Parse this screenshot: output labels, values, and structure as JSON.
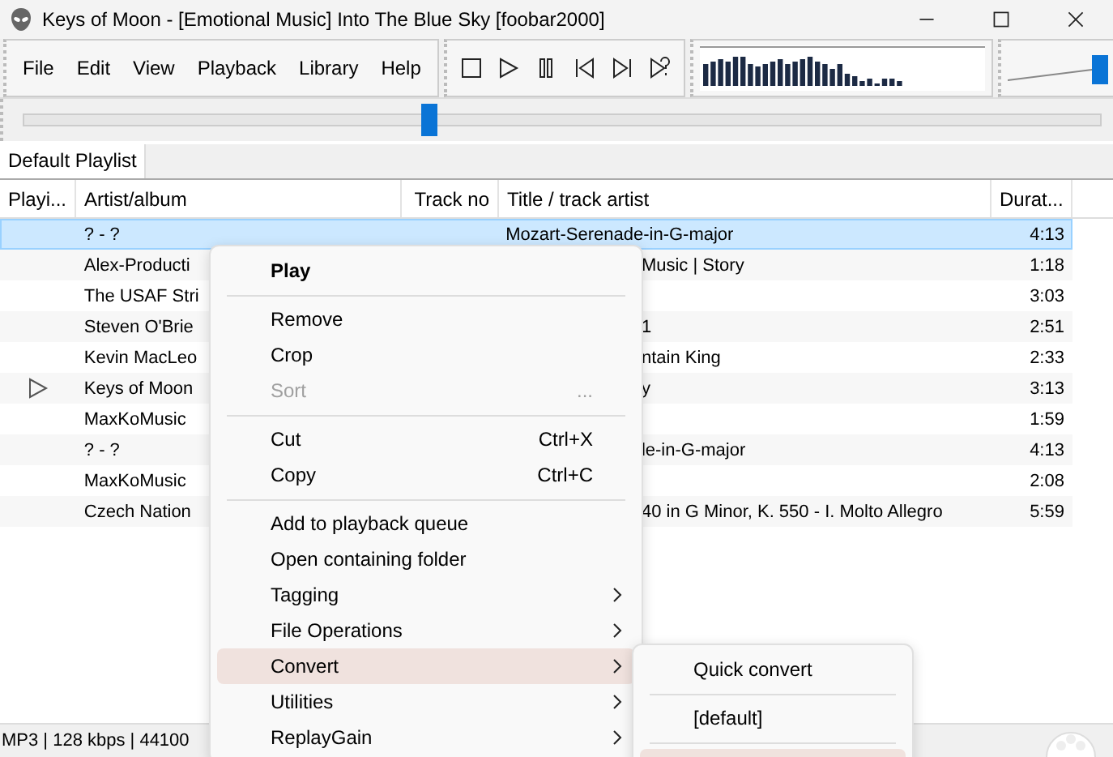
{
  "window": {
    "title": "Keys of Moon - [Emotional Music] Into The Blue Sky  [foobar2000]"
  },
  "menu_bar": [
    "File",
    "Edit",
    "View",
    "Playback",
    "Library",
    "Help"
  ],
  "volume": {
    "level": 1.0
  },
  "seek": {
    "level": 0.377
  },
  "tabs": [
    {
      "label": "Default Playlist",
      "selected": true
    }
  ],
  "playlist": {
    "columns": [
      "Playi...",
      "Artist/album",
      "Track no",
      "Title / track artist",
      "Durat..."
    ],
    "rows": [
      {
        "playing": false,
        "selected": true,
        "artist": "? - ?",
        "title": "Mozart-Serenade-in-G-major",
        "duration": "4:13"
      },
      {
        "playing": false,
        "selected": false,
        "artist": "Alex-Producti",
        "title": "Music | Story",
        "duration": "1:18"
      },
      {
        "playing": false,
        "selected": false,
        "artist": "The USAF Stri",
        "duration": "3:03"
      },
      {
        "playing": false,
        "selected": false,
        "artist": "Steven O'Brie",
        "title": "1",
        "duration": "2:51"
      },
      {
        "playing": false,
        "selected": false,
        "artist": "Kevin MacLeo",
        "title": "ntain King",
        "duration": "2:33"
      },
      {
        "playing": true,
        "selected": false,
        "artist": "Keys of Moon",
        "title": "y",
        "duration": "3:13"
      },
      {
        "playing": false,
        "selected": false,
        "artist": "MaxKoMusic",
        "duration": "1:59"
      },
      {
        "playing": false,
        "selected": false,
        "artist": "? - ?",
        "title": "le-in-G-major",
        "duration": "4:13"
      },
      {
        "playing": false,
        "selected": false,
        "artist": "MaxKoMusic",
        "duration": "2:08"
      },
      {
        "playing": false,
        "selected": false,
        "artist": "Czech Nation",
        "title": "40 in G Minor, K. 550 - I. Molto Allegro",
        "duration": "5:59"
      }
    ]
  },
  "status_bar": "MP3 | 128 kbps | 44100",
  "context_menu": [
    {
      "kind": "item",
      "label": "Play",
      "bold": true
    },
    {
      "kind": "separator"
    },
    {
      "kind": "item",
      "label": "Remove"
    },
    {
      "kind": "item",
      "label": "Crop"
    },
    {
      "kind": "item",
      "label": "Sort",
      "shortcut": "...",
      "disabled": true
    },
    {
      "kind": "separator"
    },
    {
      "kind": "item",
      "label": "Cut",
      "shortcut": "Ctrl+X"
    },
    {
      "kind": "item",
      "label": "Copy",
      "shortcut": "Ctrl+C"
    },
    {
      "kind": "separator"
    },
    {
      "kind": "item",
      "label": "Add to playback queue"
    },
    {
      "kind": "item",
      "label": "Open containing folder"
    },
    {
      "kind": "item",
      "label": "Tagging",
      "submenu": true
    },
    {
      "kind": "item",
      "label": "File Operations",
      "submenu": true
    },
    {
      "kind": "item",
      "label": "Convert",
      "submenu": true,
      "selected": true
    },
    {
      "kind": "item",
      "label": "Utilities",
      "submenu": true
    },
    {
      "kind": "item",
      "label": "ReplayGain",
      "submenu": true
    }
  ],
  "submenu": [
    {
      "kind": "item",
      "label": "Quick convert"
    },
    {
      "kind": "separator"
    },
    {
      "kind": "item",
      "label": "[default]"
    },
    {
      "kind": "separator"
    },
    {
      "kind": "item",
      "selected": true
    }
  ]
}
